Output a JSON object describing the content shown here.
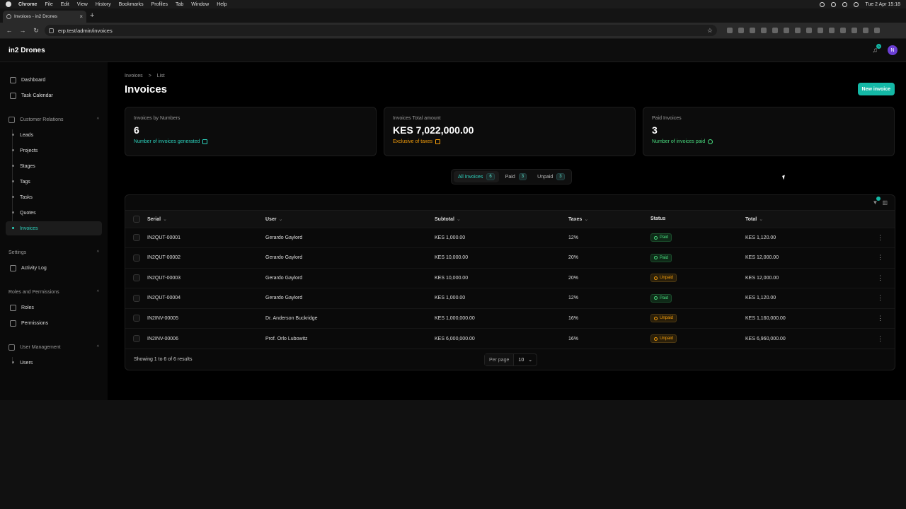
{
  "menubar": {
    "app": "Chrome",
    "items": [
      "File",
      "Edit",
      "View",
      "History",
      "Bookmarks",
      "Profiles",
      "Tab",
      "Window",
      "Help"
    ],
    "clock": "Tue 2 Apr  15:18"
  },
  "browser": {
    "tab_title": "Invoices - in2 Drones",
    "url": "erp.test/admin/invoices"
  },
  "app": {
    "brand": "in2 Drones",
    "notif_count": "0",
    "avatar_initial": "N"
  },
  "sidebar": {
    "dashboard": "Dashboard",
    "task_calendar": "Task Calendar",
    "group_crm": "Customer Relations",
    "leads": "Leads",
    "projects": "Projects",
    "stages": "Stages",
    "tags": "Tags",
    "tasks": "Tasks",
    "quotes": "Quotes",
    "invoices": "Invoices",
    "group_settings": "Settings",
    "activity_log": "Activity Log",
    "group_roles": "Roles and Permissions",
    "roles": "Roles",
    "permissions": "Permissions",
    "group_users": "User Management",
    "users": "Users"
  },
  "page": {
    "crumb_1": "Invoices",
    "crumb_sep": ">",
    "crumb_2": "List",
    "title": "Invoices",
    "new_button": "New invoice"
  },
  "stats": {
    "s1_label": "Invoices by Numbers",
    "s1_value": "6",
    "s1_desc": "Number of invoices generated",
    "s2_label": "Invoices Total amount",
    "s2_value": "KES 7,022,000.00",
    "s2_desc": "Exclusive of taxes",
    "s3_label": "Paid Invoices",
    "s3_value": "3",
    "s3_desc": "Number of invoices paid"
  },
  "filters": {
    "all_label": "All Invoices",
    "all_count": "6",
    "paid_label": "Paid",
    "paid_count": "3",
    "unpaid_label": "Unpaid",
    "unpaid_count": "3"
  },
  "table": {
    "filter_count": "0",
    "h_serial": "Serial",
    "h_user": "User",
    "h_subtotal": "Subtotal",
    "h_taxes": "Taxes",
    "h_status": "Status",
    "h_total": "Total",
    "rows": [
      {
        "serial": "IN2QUT-00001",
        "user": "Gerardo Gaylord",
        "subtotal": "KES 1,000.00",
        "taxes": "12%",
        "status": "Paid",
        "total": "KES 1,120.00"
      },
      {
        "serial": "IN2QUT-00002",
        "user": "Gerardo Gaylord",
        "subtotal": "KES 10,000.00",
        "taxes": "20%",
        "status": "Paid",
        "total": "KES 12,000.00"
      },
      {
        "serial": "IN2QUT-00003",
        "user": "Gerardo Gaylord",
        "subtotal": "KES 10,000.00",
        "taxes": "20%",
        "status": "Unpaid",
        "total": "KES 12,000.00"
      },
      {
        "serial": "IN2QUT-00004",
        "user": "Gerardo Gaylord",
        "subtotal": "KES 1,000.00",
        "taxes": "12%",
        "status": "Paid",
        "total": "KES 1,120.00"
      },
      {
        "serial": "IN2INV-00005",
        "user": "Dr. Anderson Buckridge",
        "subtotal": "KES 1,000,000.00",
        "taxes": "16%",
        "status": "Unpaid",
        "total": "KES 1,160,000.00"
      },
      {
        "serial": "IN2INV-00006",
        "user": "Prof. Orlo Lubowitz",
        "subtotal": "KES 6,000,000.00",
        "taxes": "16%",
        "status": "Unpaid",
        "total": "KES 6,960,000.00"
      }
    ],
    "footer_text": "Showing 1 to 6 of 6 results",
    "per_page_label": "Per page",
    "per_page_value": "10"
  },
  "colors": {
    "accent": "#14b8a6",
    "paid": "#4ade80",
    "unpaid": "#f59e0b",
    "avatar_bg": "#6b3fd4"
  }
}
